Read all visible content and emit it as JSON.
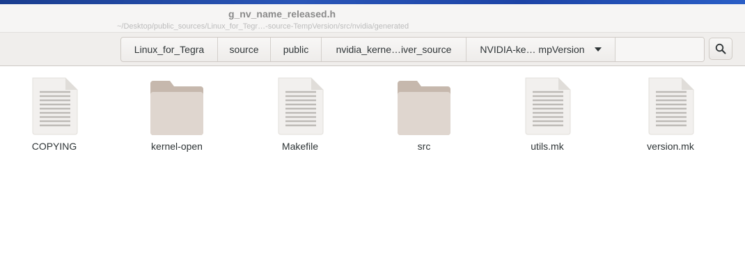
{
  "window": {
    "title": "g_nv_name_released.h",
    "path_subtitle": "~/Desktop/public_sources/Linux_for_Tegr…-source-TempVersion/src/nvidia/generated"
  },
  "pathbar": {
    "crumbs": [
      "Linux_for_Tegra",
      "source",
      "public",
      "nvidia_kerne…iver_source",
      "NVIDIA-ke… mpVersion"
    ]
  },
  "search": {
    "icon": "search-icon"
  },
  "files": [
    {
      "name": "COPYING",
      "kind": "text-file"
    },
    {
      "name": "kernel-open",
      "kind": "folder"
    },
    {
      "name": "Makefile",
      "kind": "text-file"
    },
    {
      "name": "src",
      "kind": "folder"
    },
    {
      "name": "utils.mk",
      "kind": "text-file"
    },
    {
      "name": "version.mk",
      "kind": "text-file"
    }
  ],
  "colors": {
    "folder_body": "#dfd6cf",
    "folder_tab": "#c6b8ad",
    "file_page": "#f2f0ee",
    "text_lines": "#bdbab6"
  }
}
